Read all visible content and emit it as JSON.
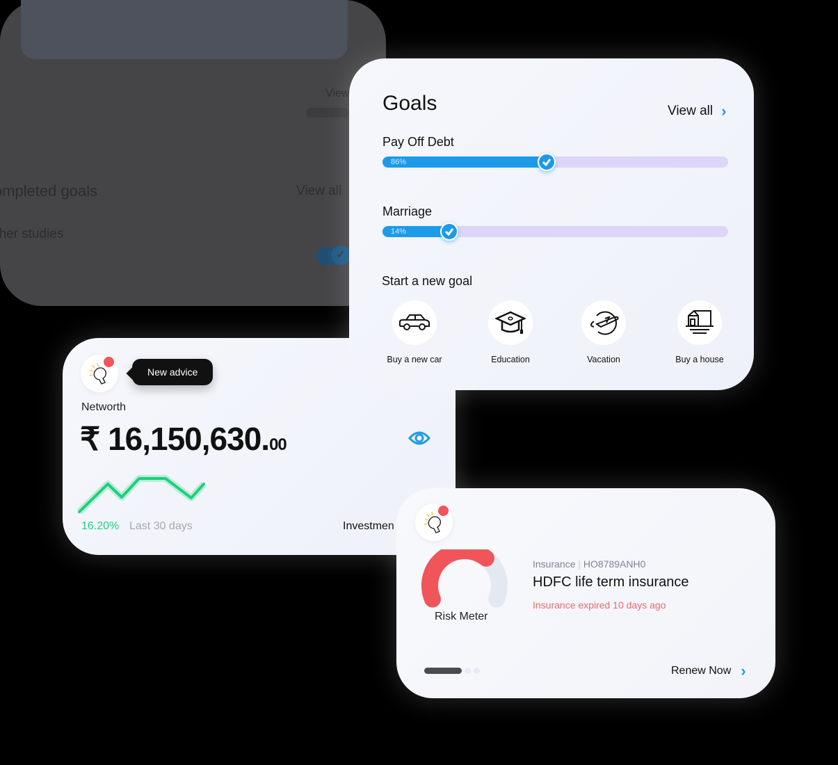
{
  "goals": {
    "title": "Goals",
    "view_all": "View all",
    "items": [
      {
        "name": "Pay Off Debt",
        "percent_label": "86%",
        "percent": 86
      },
      {
        "name": "Marriage",
        "percent_label": "14%",
        "percent": 14
      }
    ],
    "new_goal_title": "Start a new goal",
    "new_goals": [
      {
        "label": "Buy a new car",
        "icon": "car-icon"
      },
      {
        "label": "Education",
        "icon": "graduation-cap-icon"
      },
      {
        "label": "Vacation",
        "icon": "airplane-globe-icon"
      },
      {
        "label": "Buy a house",
        "icon": "house-icon"
      }
    ]
  },
  "networth": {
    "tooltip": "New advice",
    "label": "Networth",
    "currency": "₹",
    "amount": "16,150,630.",
    "decimals": "00",
    "change": "16.20%",
    "period": "Last 30 days",
    "investments": "Investmen",
    "sparkline": [
      0,
      40,
      21,
      48,
      48,
      20,
      40
    ]
  },
  "background_card": {
    "view": "View",
    "completed_title": "Completed goals",
    "view_all": "View all",
    "item": "Higher studies"
  },
  "insurance": {
    "category": "Insurance",
    "policy_id": "HO8789ANH0",
    "name": "HDFC life term insurance",
    "status": "Insurance expired 10 days ago",
    "risk_label": "Risk Meter",
    "risk_level": 0.7,
    "renew": "Renew Now",
    "carousel_pages": 3,
    "carousel_active": 1
  },
  "colors": {
    "accent": "#1e9be8",
    "positive": "#1fcf7a",
    "danger": "#f0555a",
    "track": "#ddd6f8"
  }
}
